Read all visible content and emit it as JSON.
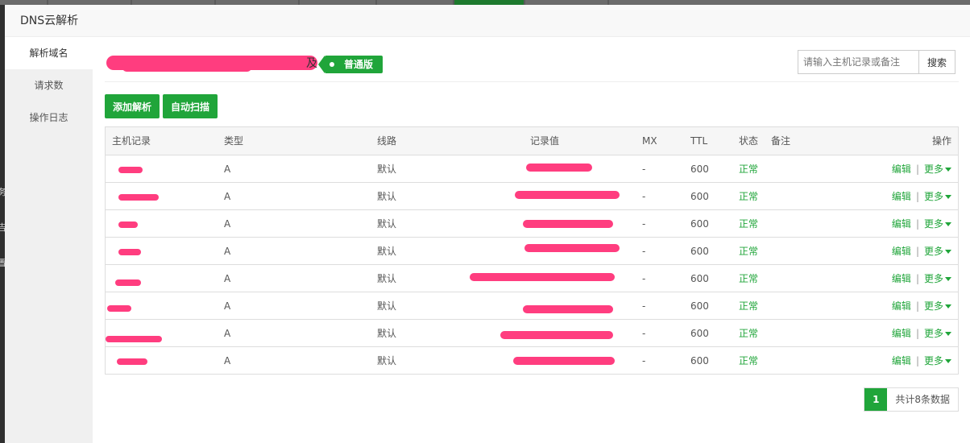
{
  "dialog": {
    "title": "DNS云解析"
  },
  "background": {
    "side_chars": [
      "务",
      "吉",
      "置"
    ]
  },
  "sidebar": {
    "items": [
      {
        "label": "解析域名",
        "active": true
      },
      {
        "label": "请求数",
        "active": false
      },
      {
        "label": "操作日志",
        "active": false
      }
    ]
  },
  "domain": {
    "tag": "普通版",
    "suffix": "及"
  },
  "search": {
    "placeholder": "请输入主机记录或备注",
    "button": "搜索"
  },
  "toolbar": {
    "add_label": "添加解析",
    "scan_label": "自动扫描"
  },
  "table": {
    "headers": {
      "host": "主机记录",
      "type": "类型",
      "line": "线路",
      "value": "记录值",
      "mx": "MX",
      "ttl": "TTL",
      "status": "状态",
      "note": "备注",
      "ops": "操作"
    },
    "rows": [
      {
        "type": "A",
        "line": "默认",
        "mx": "-",
        "ttl": "600",
        "status": "正常"
      },
      {
        "type": "A",
        "line": "默认",
        "mx": "-",
        "ttl": "600",
        "status": "正常"
      },
      {
        "type": "A",
        "line": "默认",
        "mx": "-",
        "ttl": "600",
        "status": "正常"
      },
      {
        "type": "A",
        "line": "默认",
        "mx": "-",
        "ttl": "600",
        "status": "正常"
      },
      {
        "type": "A",
        "line": "默认",
        "mx": "-",
        "ttl": "600",
        "status": "正常"
      },
      {
        "type": "A",
        "line": "默认",
        "mx": "-",
        "ttl": "600",
        "status": "正常"
      },
      {
        "type": "A",
        "line": "默认",
        "mx": "-",
        "ttl": "600",
        "status": "正常"
      },
      {
        "type": "A",
        "line": "默认",
        "mx": "-",
        "ttl": "600",
        "status": "正常"
      }
    ],
    "edit_label": "编辑",
    "more_label": "更多"
  },
  "pager": {
    "current": "1",
    "total_text": "共计8条数据"
  },
  "colors": {
    "accent": "#20a53a",
    "redaction": "#ff3d7f"
  }
}
